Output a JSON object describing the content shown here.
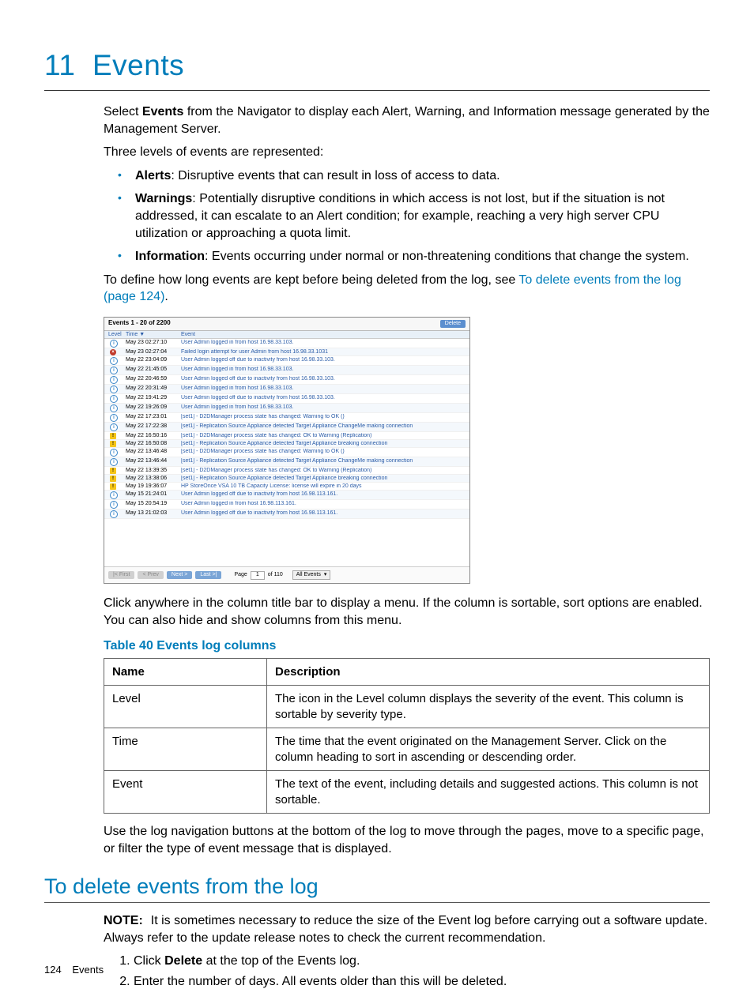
{
  "chapter": {
    "number": "11",
    "title": "Events"
  },
  "intro": {
    "p1_a": "Select ",
    "p1_b": "Events",
    "p1_c": " from the Navigator to display each Alert, Warning, and Information message generated by the Management Server.",
    "p2": "Three levels of events are represented:"
  },
  "bullets": [
    {
      "term": "Alerts",
      "text": ": Disruptive events that can result in loss of access to data."
    },
    {
      "term": "Warnings",
      "text": ": Potentially disruptive conditions in which access is not lost, but if the situation is not addressed, it can escalate to an Alert condition; for example, reaching a very high server CPU utilization or approaching a quota limit."
    },
    {
      "term": "Information",
      "text": ": Events occurring under normal or non-threatening conditions that change the system."
    }
  ],
  "link_sentence": {
    "a": "To define how long events are kept before being deleted from the log, see ",
    "link": "To delete events from the log (page 124)",
    "b": "."
  },
  "figure": {
    "title": "Events 1 - 20 of 2200",
    "delete": "Delete",
    "cols": {
      "level": "Level",
      "time": "Time ▼",
      "event": "Event"
    },
    "rows": [
      {
        "lvl": "info",
        "time": "May 23 02:27:10",
        "event": "User Admin logged in from host 16.98.33.103."
      },
      {
        "lvl": "alert",
        "time": "May 23 02:27:04",
        "event": "Failed login attempt for user Admin from host 16.98.33.1031"
      },
      {
        "lvl": "info",
        "time": "May 22 23:04:09",
        "event": "User Admin logged off due to inactivity from host 16.98.33.103."
      },
      {
        "lvl": "info",
        "time": "May 22 21:45:05",
        "event": "User Admin logged in from host 16.98.33.103."
      },
      {
        "lvl": "info",
        "time": "May 22 20:46:59",
        "event": "User Admin logged off due to inactivity from host 16.98.33.103."
      },
      {
        "lvl": "info",
        "time": "May 22 20:31:49",
        "event": "User Admin logged in from host 16.98.33.103."
      },
      {
        "lvl": "info",
        "time": "May 22 19:41:29",
        "event": "User Admin logged off due to inactivity from host 16.98.33.103."
      },
      {
        "lvl": "info",
        "time": "May 22 19:26:09",
        "event": "User Admin logged in from host 16.98.33.103."
      },
      {
        "lvl": "info",
        "time": "May 22 17:23:01",
        "event": "[set1] - D2DManager process state has changed: Warning to OK ()"
      },
      {
        "lvl": "info",
        "time": "May 22 17:22:38",
        "event": "[set1] - Replication Source Appliance detected Target Appliance ChangeMe making connection"
      },
      {
        "lvl": "warn",
        "time": "May 22 16:50:16",
        "event": "[set1] - D2DManager process state has changed: OK to Warning (Replication)"
      },
      {
        "lvl": "warn",
        "time": "May 22 16:50:08",
        "event": "[set1] - Replication Source Appliance detected Target Appliance breaking connection"
      },
      {
        "lvl": "info",
        "time": "May 22 13:46:48",
        "event": "[set1] - D2DManager process state has changed: Warning to OK ()"
      },
      {
        "lvl": "info",
        "time": "May 22 13:46:44",
        "event": "[set1] - Replication Source Appliance detected Target Appliance ChangeMe making connection"
      },
      {
        "lvl": "warn",
        "time": "May 22 13:39:35",
        "event": "[set1] - D2DManager process state has changed: OK to Warning (Replication)"
      },
      {
        "lvl": "warn",
        "time": "May 22 13:38:06",
        "event": "[set1] - Replication Source Appliance detected Target Appliance breaking connection"
      },
      {
        "lvl": "warn",
        "time": "May 19 19:36:07",
        "event": "HP StoreOnce VSA 10 TB Capacity License: license will expire in 20 days"
      },
      {
        "lvl": "info",
        "time": "May 15 21:24:01",
        "event": "User Admin logged off due to inactivity from host 16.98.113.161."
      },
      {
        "lvl": "info",
        "time": "May 15 20:54:19",
        "event": "User Admin logged in from host 16.98.113.161."
      },
      {
        "lvl": "info",
        "time": "May 13 21:02:03",
        "event": "User Admin logged off due to inactivity from host 16.98.113.161."
      }
    ],
    "footer": {
      "first": "|< First",
      "prev": "< Prev",
      "next": "Next >",
      "last": "Last >|",
      "page_label_a": "Page",
      "page_value": "1",
      "page_label_b": "of 110",
      "filter": "All Events"
    }
  },
  "after_fig": "Click anywhere in the column title bar to display a menu. If the column is sortable, sort options are enabled. You can also hide and show columns from this menu.",
  "table": {
    "caption": "Table 40 Events log columns",
    "head": {
      "name": "Name",
      "desc": "Description"
    },
    "rows": [
      {
        "name": "Level",
        "desc": "The icon in the Level column displays the severity of the event. This column is sortable by severity type."
      },
      {
        "name": "Time",
        "desc": "The time that the event originated on the Management Server. Click on the column heading to sort in ascending or descending order."
      },
      {
        "name": "Event",
        "desc": "The text of the event, including details and suggested actions. This column is not sortable."
      }
    ]
  },
  "after_table": "Use the log navigation buttons at the bottom of the log to move through the pages, move to a specific page, or filter the type of event message that is displayed.",
  "section2": {
    "title": "To delete events from the log",
    "note_label": "NOTE:",
    "note_text": "It is sometimes necessary to reduce the size of the Event log before carrying out a software update. Always refer to the update release notes to check the current recommendation.",
    "steps": [
      {
        "a": "Click ",
        "b": "Delete",
        "c": " at the top of the Events log."
      },
      {
        "a": "Enter the number of days. All events older than this will be deleted.",
        "b": "",
        "c": ""
      }
    ]
  },
  "footer": {
    "page": "124",
    "label": "Events"
  }
}
